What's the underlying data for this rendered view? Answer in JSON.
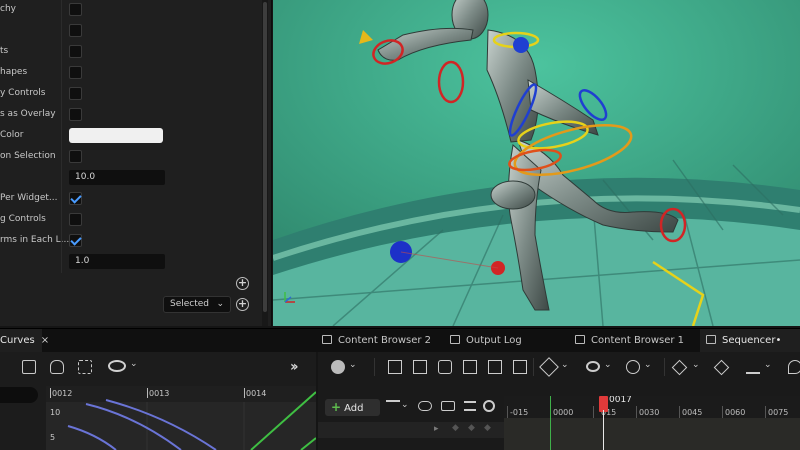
{
  "details_panel": {
    "rows": [
      {
        "label": "chy",
        "control": "checkbox",
        "checked": false
      },
      {
        "label": "",
        "control": "checkbox",
        "checked": false
      },
      {
        "label": "ts",
        "control": "checkbox",
        "checked": false
      },
      {
        "label": "hapes",
        "control": "checkbox",
        "checked": false
      },
      {
        "label": "y Controls",
        "control": "checkbox",
        "checked": false
      },
      {
        "label": "s as Overlay",
        "control": "checkbox",
        "checked": false
      },
      {
        "label": "Color",
        "control": "color",
        "color": "#f0f0f0"
      },
      {
        "label": "on Selection",
        "control": "checkbox",
        "checked": false
      },
      {
        "label": "",
        "control": "number",
        "value": "10.0"
      },
      {
        "label": "Per Widget...",
        "control": "checkbox",
        "checked": true
      },
      {
        "label": "g Controls",
        "control": "checkbox",
        "checked": false
      },
      {
        "label": "rms in Each L...",
        "control": "checkbox",
        "checked": true
      },
      {
        "label": "",
        "control": "number",
        "value": "1.0"
      }
    ],
    "selected_dropdown": "Selected",
    "icons": {
      "add": "plus-circle-icon"
    }
  },
  "tabs": {
    "curves": {
      "label": "Curves",
      "close": "×"
    },
    "content_browser_2": {
      "label": "Content Browser 2"
    },
    "output_log": {
      "label": "Output Log"
    },
    "content_browser_1": {
      "label": "Content Browser 1"
    },
    "sequencer": {
      "label": "Sequencer•"
    }
  },
  "curves": {
    "frames": [
      "0012",
      "0013",
      "0014"
    ],
    "y_values": [
      "10",
      "5"
    ],
    "curve_colors": [
      "#6a74d6",
      "#3fbf43"
    ]
  },
  "sequencer": {
    "add_label": "Add",
    "playhead_frame": "0017",
    "ruler": [
      "-015",
      "0000",
      "0015",
      "0030",
      "0045",
      "0060",
      "0075"
    ],
    "ruler_shown": [
      "-015",
      "0000",
      "015",
      "0030",
      "0045",
      "0060",
      "0075"
    ],
    "colors": {
      "playhead": "#e03a3a",
      "start_marker": "#3fb04a"
    }
  },
  "colors": {
    "panel_bg": "#1f1f1f",
    "viewport_bg": "#39a083",
    "accent_check": "#4a9cff"
  }
}
